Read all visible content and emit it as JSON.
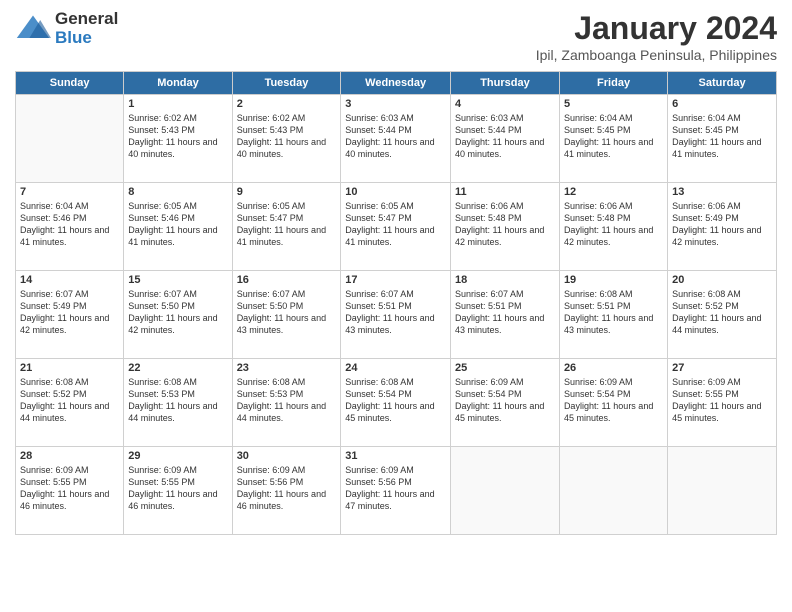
{
  "header": {
    "logo_general": "General",
    "logo_blue": "Blue",
    "month_title": "January 2024",
    "subtitle": "Ipil, Zamboanga Peninsula, Philippines"
  },
  "days": [
    "Sunday",
    "Monday",
    "Tuesday",
    "Wednesday",
    "Thursday",
    "Friday",
    "Saturday"
  ],
  "weeks": [
    [
      {
        "date": "",
        "info": ""
      },
      {
        "date": "1",
        "info": "Sunrise: 6:02 AM\nSunset: 5:43 PM\nDaylight: 11 hours\nand 40 minutes."
      },
      {
        "date": "2",
        "info": "Sunrise: 6:02 AM\nSunset: 5:43 PM\nDaylight: 11 hours\nand 40 minutes."
      },
      {
        "date": "3",
        "info": "Sunrise: 6:03 AM\nSunset: 5:44 PM\nDaylight: 11 hours\nand 40 minutes."
      },
      {
        "date": "4",
        "info": "Sunrise: 6:03 AM\nSunset: 5:44 PM\nDaylight: 11 hours\nand 40 minutes."
      },
      {
        "date": "5",
        "info": "Sunrise: 6:04 AM\nSunset: 5:45 PM\nDaylight: 11 hours\nand 41 minutes."
      },
      {
        "date": "6",
        "info": "Sunrise: 6:04 AM\nSunset: 5:45 PM\nDaylight: 11 hours\nand 41 minutes."
      }
    ],
    [
      {
        "date": "7",
        "info": "Sunrise: 6:04 AM\nSunset: 5:46 PM\nDaylight: 11 hours\nand 41 minutes."
      },
      {
        "date": "8",
        "info": "Sunrise: 6:05 AM\nSunset: 5:46 PM\nDaylight: 11 hours\nand 41 minutes."
      },
      {
        "date": "9",
        "info": "Sunrise: 6:05 AM\nSunset: 5:47 PM\nDaylight: 11 hours\nand 41 minutes."
      },
      {
        "date": "10",
        "info": "Sunrise: 6:05 AM\nSunset: 5:47 PM\nDaylight: 11 hours\nand 41 minutes."
      },
      {
        "date": "11",
        "info": "Sunrise: 6:06 AM\nSunset: 5:48 PM\nDaylight: 11 hours\nand 42 minutes."
      },
      {
        "date": "12",
        "info": "Sunrise: 6:06 AM\nSunset: 5:48 PM\nDaylight: 11 hours\nand 42 minutes."
      },
      {
        "date": "13",
        "info": "Sunrise: 6:06 AM\nSunset: 5:49 PM\nDaylight: 11 hours\nand 42 minutes."
      }
    ],
    [
      {
        "date": "14",
        "info": "Sunrise: 6:07 AM\nSunset: 5:49 PM\nDaylight: 11 hours\nand 42 minutes."
      },
      {
        "date": "15",
        "info": "Sunrise: 6:07 AM\nSunset: 5:50 PM\nDaylight: 11 hours\nand 42 minutes."
      },
      {
        "date": "16",
        "info": "Sunrise: 6:07 AM\nSunset: 5:50 PM\nDaylight: 11 hours\nand 43 minutes."
      },
      {
        "date": "17",
        "info": "Sunrise: 6:07 AM\nSunset: 5:51 PM\nDaylight: 11 hours\nand 43 minutes."
      },
      {
        "date": "18",
        "info": "Sunrise: 6:07 AM\nSunset: 5:51 PM\nDaylight: 11 hours\nand 43 minutes."
      },
      {
        "date": "19",
        "info": "Sunrise: 6:08 AM\nSunset: 5:51 PM\nDaylight: 11 hours\nand 43 minutes."
      },
      {
        "date": "20",
        "info": "Sunrise: 6:08 AM\nSunset: 5:52 PM\nDaylight: 11 hours\nand 44 minutes."
      }
    ],
    [
      {
        "date": "21",
        "info": "Sunrise: 6:08 AM\nSunset: 5:52 PM\nDaylight: 11 hours\nand 44 minutes."
      },
      {
        "date": "22",
        "info": "Sunrise: 6:08 AM\nSunset: 5:53 PM\nDaylight: 11 hours\nand 44 minutes."
      },
      {
        "date": "23",
        "info": "Sunrise: 6:08 AM\nSunset: 5:53 PM\nDaylight: 11 hours\nand 44 minutes."
      },
      {
        "date": "24",
        "info": "Sunrise: 6:08 AM\nSunset: 5:54 PM\nDaylight: 11 hours\nand 45 minutes."
      },
      {
        "date": "25",
        "info": "Sunrise: 6:09 AM\nSunset: 5:54 PM\nDaylight: 11 hours\nand 45 minutes."
      },
      {
        "date": "26",
        "info": "Sunrise: 6:09 AM\nSunset: 5:54 PM\nDaylight: 11 hours\nand 45 minutes."
      },
      {
        "date": "27",
        "info": "Sunrise: 6:09 AM\nSunset: 5:55 PM\nDaylight: 11 hours\nand 45 minutes."
      }
    ],
    [
      {
        "date": "28",
        "info": "Sunrise: 6:09 AM\nSunset: 5:55 PM\nDaylight: 11 hours\nand 46 minutes."
      },
      {
        "date": "29",
        "info": "Sunrise: 6:09 AM\nSunset: 5:55 PM\nDaylight: 11 hours\nand 46 minutes."
      },
      {
        "date": "30",
        "info": "Sunrise: 6:09 AM\nSunset: 5:56 PM\nDaylight: 11 hours\nand 46 minutes."
      },
      {
        "date": "31",
        "info": "Sunrise: 6:09 AM\nSunset: 5:56 PM\nDaylight: 11 hours\nand 47 minutes."
      },
      {
        "date": "",
        "info": ""
      },
      {
        "date": "",
        "info": ""
      },
      {
        "date": "",
        "info": ""
      }
    ]
  ]
}
